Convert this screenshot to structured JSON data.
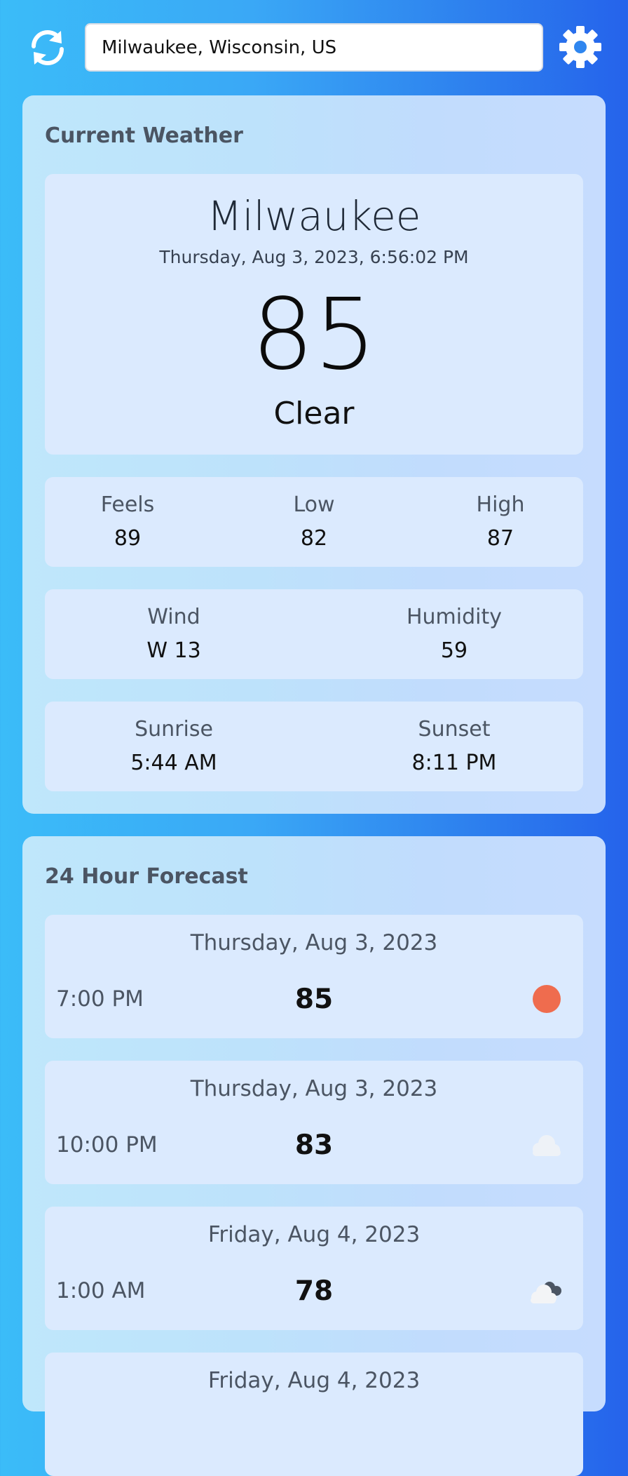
{
  "header": {
    "location_value": "Milwaukee, Wisconsin, US",
    "refresh_icon": "refresh-icon",
    "settings_icon": "gear-icon"
  },
  "current": {
    "title": "Current Weather",
    "city": "Milwaukee",
    "datetime": "Thursday, Aug 3, 2023, 6:56:02 PM",
    "temperature": "85",
    "condition": "Clear",
    "feels_label": "Feels",
    "feels_value": "89",
    "low_label": "Low",
    "low_value": "82",
    "high_label": "High",
    "high_value": "87",
    "wind_label": "Wind",
    "wind_value": "W 13",
    "humidity_label": "Humidity",
    "humidity_value": "59",
    "sunrise_label": "Sunrise",
    "sunrise_value": "5:44 AM",
    "sunset_label": "Sunset",
    "sunset_value": "8:11 PM"
  },
  "forecast": {
    "title": "24 Hour Forecast",
    "items": [
      {
        "date": "Thursday, Aug 3, 2023",
        "time": "7:00 PM",
        "temp": "85",
        "icon": "sun-icon"
      },
      {
        "date": "Thursday, Aug 3, 2023",
        "time": "10:00 PM",
        "temp": "83",
        "icon": "cloud-icon"
      },
      {
        "date": "Friday, Aug 4, 2023",
        "time": "1:00 AM",
        "temp": "78",
        "icon": "cloudy-night-icon"
      },
      {
        "date": "Friday, Aug 4, 2023"
      }
    ]
  },
  "colors": {
    "sun": "#ef6c4e",
    "card": "#dbeafe"
  }
}
